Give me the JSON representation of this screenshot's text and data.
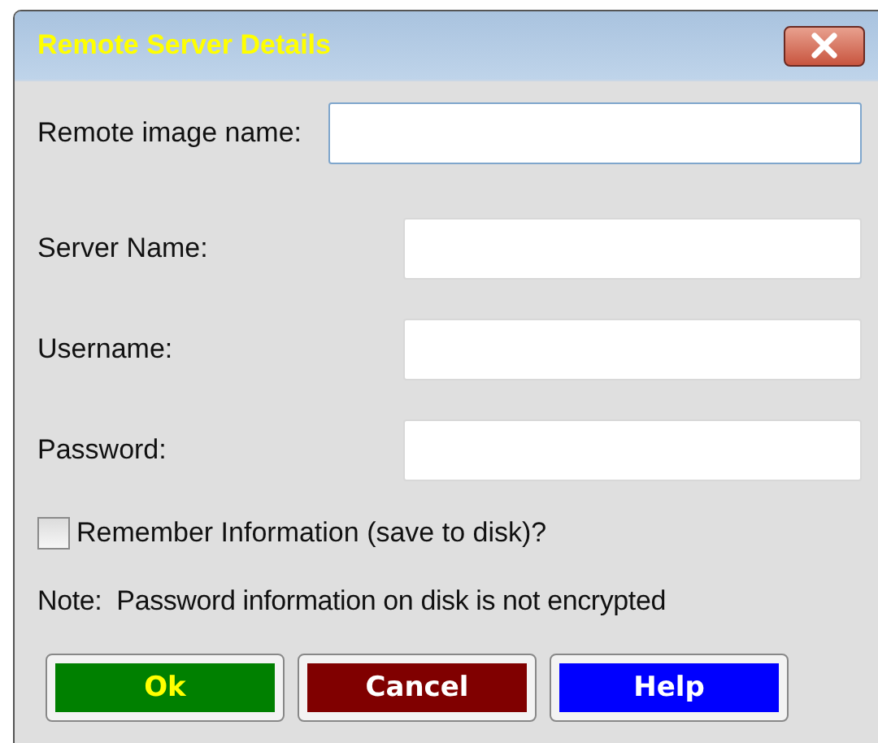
{
  "window": {
    "title": "Remote Server Details"
  },
  "fields": [
    {
      "label": "Remote image name:",
      "focused": true
    },
    {
      "label": "Server Name:",
      "focused": false
    },
    {
      "label": "Username:",
      "focused": false
    },
    {
      "label": "Password:",
      "focused": false
    }
  ],
  "remember": {
    "label": "Remember Information (save to disk)?",
    "checked": false
  },
  "note": "Note:  Password information on disk is not encrypted",
  "buttons": [
    {
      "label": "Ok",
      "color": "#008000",
      "kind": "accept"
    },
    {
      "label": "Cancel",
      "color": "#800000",
      "kind": "plain"
    },
    {
      "label": "Help",
      "color": "#0000ff",
      "kind": "plain"
    }
  ]
}
